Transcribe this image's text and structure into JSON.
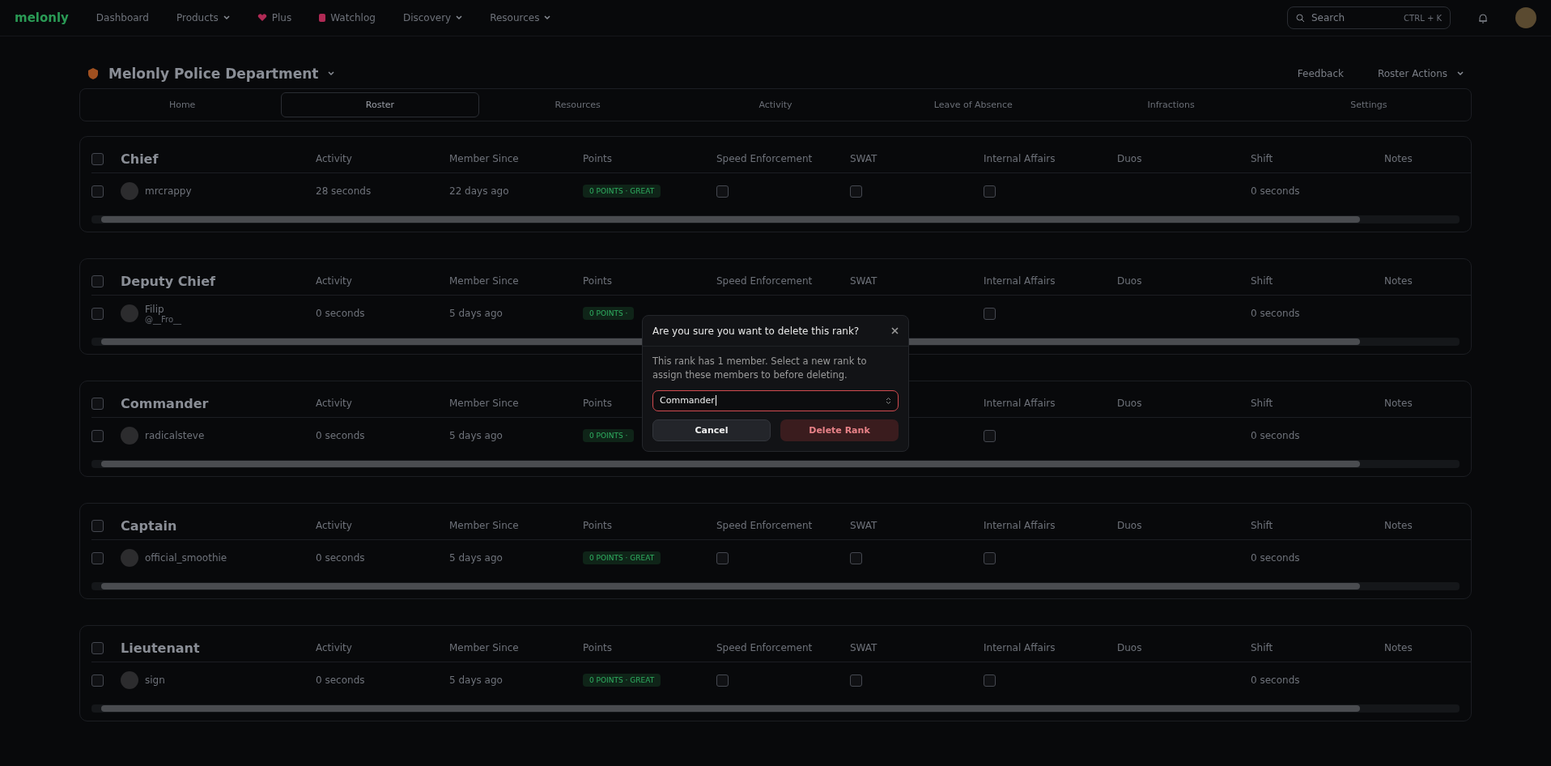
{
  "nav": {
    "logo": "melonly",
    "items": [
      {
        "label": "Dashboard",
        "kind": "link"
      },
      {
        "label": "Products",
        "kind": "menu"
      },
      {
        "label": "Plus",
        "kind": "plus"
      },
      {
        "label": "Watchlog",
        "kind": "watch"
      },
      {
        "label": "Discovery",
        "kind": "menu"
      },
      {
        "label": "Resources",
        "kind": "menu"
      }
    ],
    "search": {
      "placeholder": "Search",
      "shortcut": "CTRL + K"
    }
  },
  "header": {
    "title": "Melonly Police Department",
    "feedback": "Feedback",
    "actions": "Roster Actions"
  },
  "tabs": [
    {
      "label": "Home",
      "selected": false
    },
    {
      "label": "Roster",
      "selected": true
    },
    {
      "label": "Resources",
      "selected": false
    },
    {
      "label": "Activity",
      "selected": false
    },
    {
      "label": "Leave of Absence",
      "selected": false
    },
    {
      "label": "Infractions",
      "selected": false
    },
    {
      "label": "Settings",
      "selected": false
    }
  ],
  "ranks": [
    {
      "name": "Chief",
      "selected": false,
      "columns": [
        "Activity",
        "Member Since",
        "Points",
        "Speed Enforcement",
        "SWAT",
        "Internal Affairs",
        "Duos",
        "Shift",
        "Notes"
      ],
      "members": [
        {
          "name": "mrcrappy",
          "selected": false,
          "activity": "28 seconds",
          "since": "22 days ago",
          "points": "0 POINTS · GREAT",
          "speed": false,
          "swat": false,
          "ia": false,
          "shift": "0 seconds"
        }
      ]
    },
    {
      "name": "Deputy Chief",
      "selected": false,
      "columns": [
        "Activity",
        "Member Since",
        "Points",
        "Speed Enforcement",
        "SWAT",
        "Internal Affairs",
        "Duos",
        "Shift",
        "Notes"
      ],
      "members": [
        {
          "name": "Filip",
          "handle": "@__Fro__",
          "selected": false,
          "activity": "0 seconds",
          "since": "5 days ago",
          "points": "0 POINTS ·",
          "ia": false,
          "shift": "0 seconds"
        }
      ]
    },
    {
      "name": "Commander",
      "selected": false,
      "columns": [
        "Activity",
        "Member Since",
        "Points",
        null,
        null,
        "Internal Affairs",
        "Duos",
        "Shift",
        "Notes"
      ],
      "members": [
        {
          "name": "radicalsteve",
          "selected": false,
          "activity": "0 seconds",
          "since": "5 days ago",
          "points": "0 POINTS ·",
          "ia": false,
          "shift": "0 seconds"
        }
      ]
    },
    {
      "name": "Captain",
      "selected": false,
      "columns": [
        "Activity",
        "Member Since",
        "Points",
        "Speed Enforcement",
        "SWAT",
        "Internal Affairs",
        "Duos",
        "Shift",
        "Notes"
      ],
      "members": [
        {
          "name": "official_smoothie",
          "selected": false,
          "activity": "0 seconds",
          "since": "5 days ago",
          "points": "0 POINTS · GREAT",
          "speed": false,
          "swat": false,
          "ia": false,
          "shift": "0 seconds"
        }
      ]
    },
    {
      "name": "Lieutenant",
      "selected": false,
      "columns": [
        "Activity",
        "Member Since",
        "Points",
        "Speed Enforcement",
        "SWAT",
        "Internal Affairs",
        "Duos",
        "Shift",
        "Notes"
      ],
      "members": [
        {
          "name": "sign",
          "selected": false,
          "activity": "0 seconds",
          "since": "5 days ago",
          "points": "0 POINTS · GREAT",
          "speed": false,
          "swat": false,
          "ia": false,
          "shift": "0 seconds"
        }
      ]
    }
  ],
  "dialog": {
    "title": "Are you sure you want to delete this rank?",
    "message": "This rank has 1 member. Select a new rank to assign these members to before deleting.",
    "select": {
      "value": "Commander",
      "focused": true
    },
    "cancel": "Cancel",
    "confirm": "Delete Rank"
  }
}
